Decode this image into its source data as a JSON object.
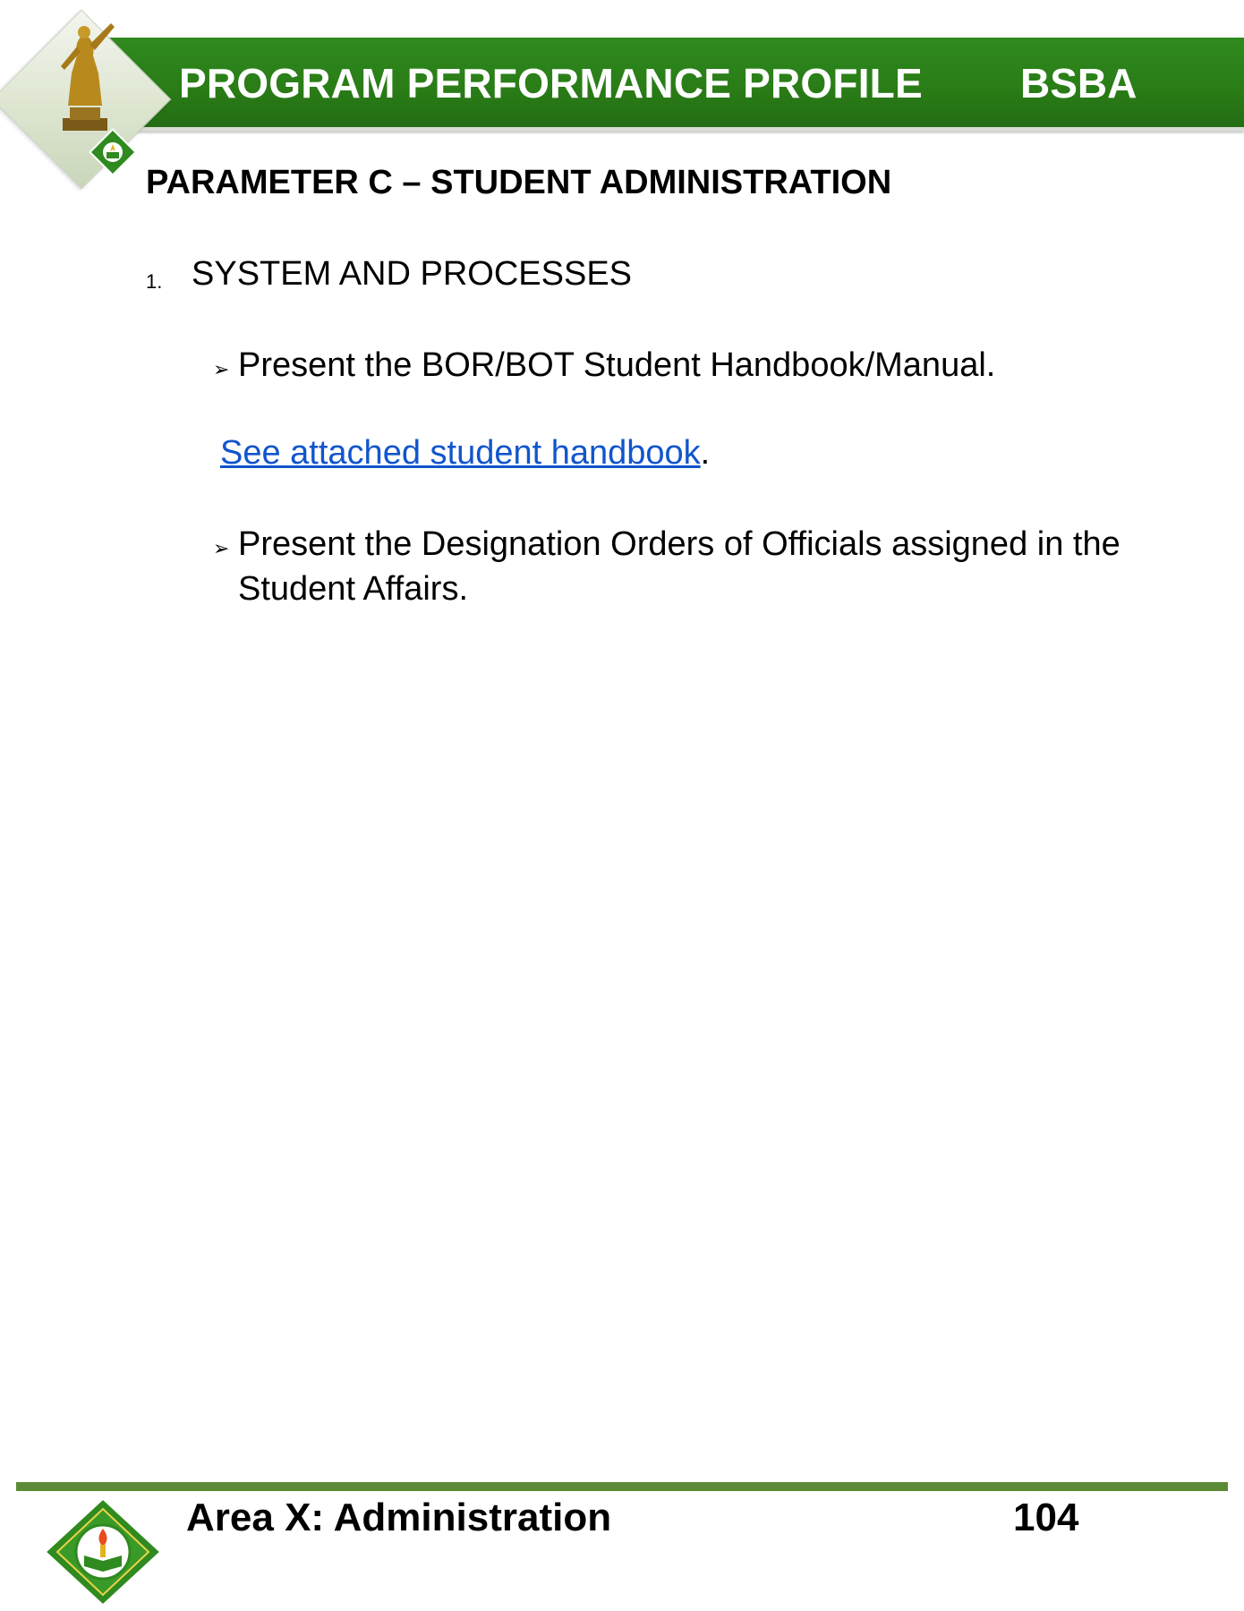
{
  "header": {
    "title": "PROGRAM PERFORMANCE PROFILE",
    "program_code": "BSBA"
  },
  "section": {
    "heading": "PARAMETER C – STUDENT ADMINISTRATION",
    "item_number": "1.",
    "item_title": "SYSTEM AND PROCESSES",
    "bullets": [
      {
        "text": "Present the BOR/BOT Student Handbook/Manual."
      },
      {
        "text_line1": "Present the Designation Orders of Officials assigned in the",
        "text_line2": "Student Affairs."
      }
    ],
    "link": {
      "label": "See attached student handbook",
      "suffix": "."
    }
  },
  "footer": {
    "area_title": "Area X: Administration",
    "page_number": "104"
  },
  "colors": {
    "header_green": "#2a7d17",
    "footer_rule": "#5c8a36",
    "link_blue": "#1155cc"
  }
}
